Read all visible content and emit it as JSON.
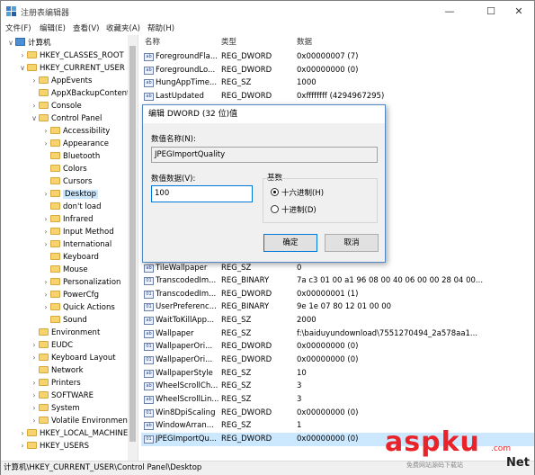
{
  "window": {
    "title": "注册表编辑器",
    "controls": [
      "—",
      "☐",
      "✕"
    ]
  },
  "menu": [
    "文件(F)",
    "编辑(E)",
    "查看(V)",
    "收藏夹(A)",
    "帮助(H)"
  ],
  "tree": [
    {
      "label": "计算机",
      "exp": "∨",
      "level": 0,
      "kind": "pc"
    },
    {
      "label": "HKEY_CLASSES_ROOT",
      "exp": "›",
      "level": 1
    },
    {
      "label": "HKEY_CURRENT_USER",
      "exp": "∨",
      "level": 1
    },
    {
      "label": "AppEvents",
      "exp": "›",
      "level": 2
    },
    {
      "label": "AppXBackupContent",
      "exp": "",
      "level": 2
    },
    {
      "label": "Console",
      "exp": "›",
      "level": 2
    },
    {
      "label": "Control Panel",
      "exp": "∨",
      "level": 2
    },
    {
      "label": "Accessibility",
      "exp": "›",
      "level": 3
    },
    {
      "label": "Appearance",
      "exp": "›",
      "level": 3
    },
    {
      "label": "Bluetooth",
      "exp": "",
      "level": 3
    },
    {
      "label": "Colors",
      "exp": "",
      "level": 3
    },
    {
      "label": "Cursors",
      "exp": "",
      "level": 3
    },
    {
      "label": "Desktop",
      "exp": "›",
      "level": 3,
      "selected": true
    },
    {
      "label": "don't load",
      "exp": "",
      "level": 3
    },
    {
      "label": "Infrared",
      "exp": "›",
      "level": 3
    },
    {
      "label": "Input Method",
      "exp": "›",
      "level": 3
    },
    {
      "label": "International",
      "exp": "›",
      "level": 3
    },
    {
      "label": "Keyboard",
      "exp": "",
      "level": 3
    },
    {
      "label": "Mouse",
      "exp": "",
      "level": 3
    },
    {
      "label": "Personalization",
      "exp": "›",
      "level": 3
    },
    {
      "label": "PowerCfg",
      "exp": "›",
      "level": 3
    },
    {
      "label": "Quick Actions",
      "exp": "›",
      "level": 3
    },
    {
      "label": "Sound",
      "exp": "",
      "level": 3
    },
    {
      "label": "Environment",
      "exp": "",
      "level": 2
    },
    {
      "label": "EUDC",
      "exp": "›",
      "level": 2
    },
    {
      "label": "Keyboard Layout",
      "exp": "›",
      "level": 2
    },
    {
      "label": "Network",
      "exp": "",
      "level": 2
    },
    {
      "label": "Printers",
      "exp": "›",
      "level": 2
    },
    {
      "label": "SOFTWARE",
      "exp": "›",
      "level": 2
    },
    {
      "label": "System",
      "exp": "›",
      "level": 2
    },
    {
      "label": "Volatile Environmen",
      "exp": "›",
      "level": 2
    },
    {
      "label": "HKEY_LOCAL_MACHINE",
      "exp": "›",
      "level": 1
    },
    {
      "label": "HKEY_USERS",
      "exp": "›",
      "level": 1
    }
  ],
  "columns": [
    "名称",
    "类型",
    "数据"
  ],
  "rows": [
    {
      "name": "ForegroundFla...",
      "type": "REG_DWORD",
      "data": "0x00000007 (7)",
      "ico": "ab"
    },
    {
      "name": "ForegroundLo...",
      "type": "REG_DWORD",
      "data": "0x00000000 (0)",
      "ico": "ab"
    },
    {
      "name": "HungAppTime...",
      "type": "REG_SZ",
      "data": "1000",
      "ico": "ab"
    },
    {
      "name": "LastUpdated",
      "type": "REG_DWORD",
      "data": "0xffffffff (4294967295)",
      "ico": "ab"
    },
    {
      "name": "TileWallpaper",
      "type": "REG_SZ",
      "data": "0",
      "ico": "ab"
    },
    {
      "name": "TranscodedIm...",
      "type": "REG_BINARY",
      "data": "7a c3 01 00 a1 96 08 00 40 06 00 00 28 04 00...",
      "ico": "01"
    },
    {
      "name": "TranscodedIm...",
      "type": "REG_DWORD",
      "data": "0x00000001 (1)",
      "ico": "01"
    },
    {
      "name": "UserPreferenc...",
      "type": "REG_BINARY",
      "data": "9e 1e 07 80 12 01 00 00",
      "ico": "01"
    },
    {
      "name": "WaitToKillApp...",
      "type": "REG_SZ",
      "data": "2000",
      "ico": "ab"
    },
    {
      "name": "Wallpaper",
      "type": "REG_SZ",
      "data": "f:\\baiduyundownload\\7551270494_2a578aa1...",
      "ico": "ab"
    },
    {
      "name": "WallpaperOri...",
      "type": "REG_DWORD",
      "data": "0x00000000 (0)",
      "ico": "01"
    },
    {
      "name": "WallpaperOri...",
      "type": "REG_DWORD",
      "data": "0x00000000 (0)",
      "ico": "01"
    },
    {
      "name": "WallpaperStyle",
      "type": "REG_SZ",
      "data": "10",
      "ico": "ab"
    },
    {
      "name": "WheelScrollCh...",
      "type": "REG_SZ",
      "data": "3",
      "ico": "ab"
    },
    {
      "name": "WheelScrollLin...",
      "type": "REG_SZ",
      "data": "3",
      "ico": "ab"
    },
    {
      "name": "Win8DpiScaling",
      "type": "REG_DWORD",
      "data": "0x00000000 (0)",
      "ico": "01"
    },
    {
      "name": "WindowArran...",
      "type": "REG_SZ",
      "data": "1",
      "ico": "ab"
    },
    {
      "name": "JPEGImportQu...",
      "type": "REG_DWORD",
      "data": "0x00000000 (0)",
      "ico": "01",
      "selected": true
    }
  ],
  "status_path": "计算机\\HKEY_CURRENT_USER\\Control Panel\\Desktop",
  "dialog": {
    "title": "编辑 DWORD (32 位)值",
    "name_label": "数值名称(N):",
    "name_value": "JPEGImportQuality",
    "data_label": "数值数据(V):",
    "data_value": "100",
    "base_label": "基数",
    "hex_label": "十六进制(H)",
    "dec_label": "十进制(D)",
    "selected_base": "hex",
    "ok_label": "确定",
    "cancel_label": "取消"
  },
  "watermark": {
    "brand": "aspku",
    "domain_tag": ".com",
    "net": "Net",
    "tagline": "免费网站源码下载站"
  }
}
